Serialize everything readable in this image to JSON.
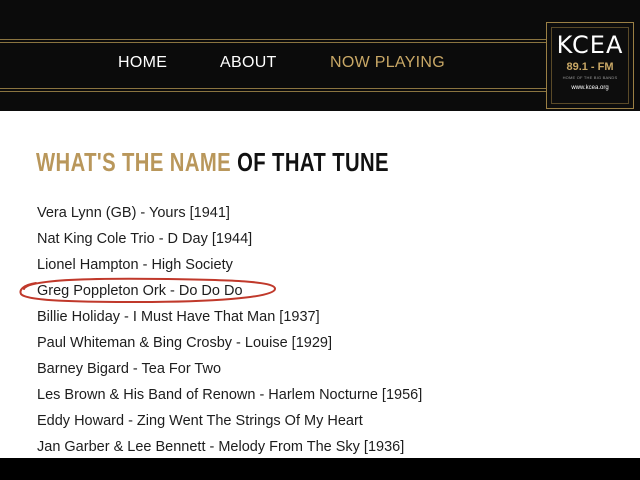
{
  "header": {
    "nav": [
      {
        "label": "HOME"
      },
      {
        "label": "ABOUT"
      },
      {
        "label": "NOW PLAYING"
      }
    ],
    "logo": {
      "call": "KCEA",
      "frequency": "89.1 - FM",
      "tagline": "HOME OF THE BIG BANDS",
      "url": "www.kcea.org"
    }
  },
  "main": {
    "headline_gold": "WHAT'S THE NAME",
    "headline_dark": "OF THAT TUNE",
    "songs": [
      "Vera Lynn (GB) - Yours [1941]",
      "Nat King Cole Trio - D Day [1944]",
      "Lionel Hampton - High Society",
      "Greg Poppleton Ork - Do Do Do",
      "Billie Holiday - I Must Have That Man [1937]",
      "Paul Whiteman & Bing Crosby - Louise [1929]",
      "Barney Bigard - Tea For Two",
      "Les Brown & His Band of Renown - Harlem Nocturne [1956]",
      "Eddy Howard - Zing Went The Strings Of My Heart",
      "Jan Garber & Lee Bennett - Melody From The Sky [1936]"
    ]
  },
  "colors": {
    "accent_gold": "#b9975b",
    "active_nav": "#c9a866",
    "annotation_circle": "#c0392b",
    "header_bg": "#0b0b0b"
  }
}
